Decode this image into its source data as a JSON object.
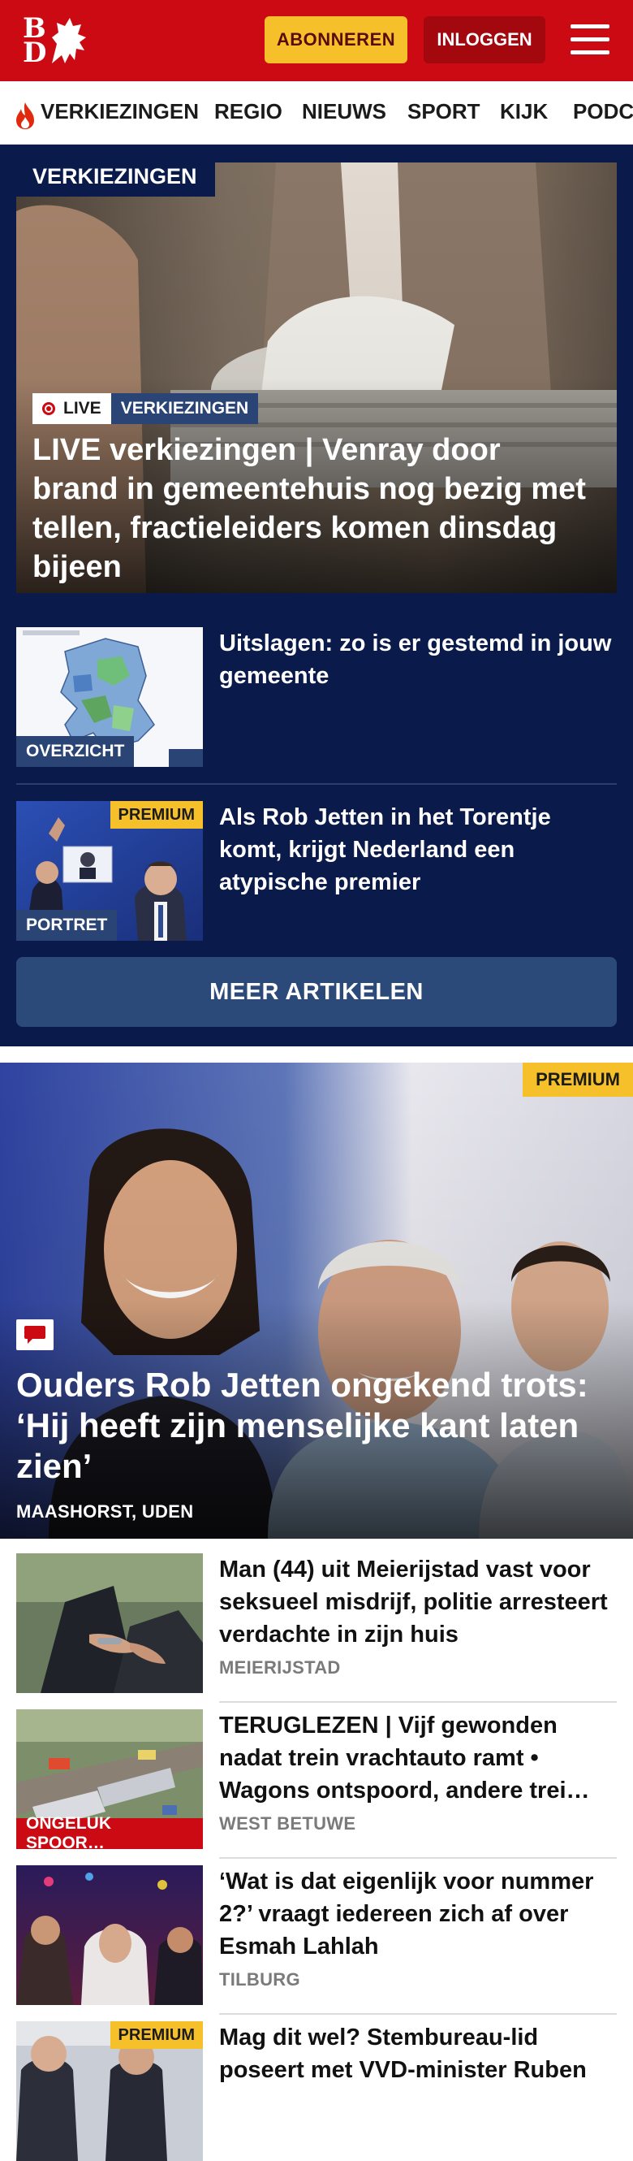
{
  "brand": {
    "logo_top": "B",
    "logo_bottom": "D",
    "accent": "#cc0a13",
    "navy": "#0a1a4a"
  },
  "header": {
    "subscribe_label": "ABONNEREN",
    "login_label": "INLOGGEN",
    "menu_icon": "hamburger-icon"
  },
  "nav": {
    "items": [
      "VERKIEZINGEN",
      "REGIO",
      "NIEUWS",
      "SPORT",
      "KIJK",
      "PODCASTS"
    ],
    "active_icon": "flame-icon"
  },
  "election": {
    "section_tag": "VERKIEZINGEN",
    "hero": {
      "live_label": "LIVE",
      "category": "VERKIEZINGEN",
      "title": "LIVE verkiezingen | Venray door brand in gemeentehuis nog bezig met tellen, fractieleiders komen dinsdag bijeen"
    },
    "articles": [
      {
        "label": "OVERZICHT",
        "title": "Uitslagen: zo is er gestemd in jouw gemeente",
        "premium": ""
      },
      {
        "label": "PORTRET",
        "title": "Als Rob Jetten in het Torentje komt, krijgt Nederland een atypische premier",
        "premium": "PREMIUM"
      }
    ],
    "more_label": "MEER ARTIKELEN"
  },
  "feature": {
    "premium": "PREMIUM",
    "title": "Ouders Rob Jetten ongekend trots: ‘Hij heeft zijn menselijke kant laten zien’",
    "location": "MAASHORST, UDEN"
  },
  "news": [
    {
      "title": "Man (44) uit Meierijstad vast voor seksueel misdrijf, politie arresteert verdachte in zijn huis",
      "location": "MEIERIJSTAD",
      "label": "",
      "premium": ""
    },
    {
      "title": "TERUGLEZEN | Vijf gewonden nadat trein vrachtauto ramt • Wagons ontspoord, andere trei…",
      "location": "WEST BETUWE",
      "label": "ONGELUK SPOOR…",
      "premium": ""
    },
    {
      "title": "‘Wat is dat eigenlijk voor nummer 2?’ vraagt iedereen zich af over Esmah Lahlah",
      "location": "TILBURG",
      "label": "",
      "premium": ""
    },
    {
      "title": "Mag dit wel? Stembureau-lid poseert met VVD-minister Ruben",
      "location": "",
      "label": "",
      "premium": "PREMIUM"
    }
  ]
}
